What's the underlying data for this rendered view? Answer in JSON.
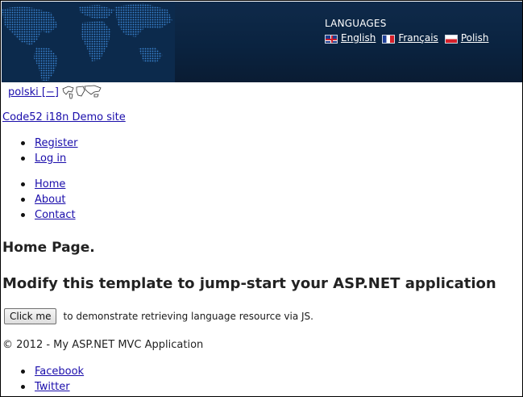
{
  "header": {
    "languages_title": "LANGUAGES",
    "languages": [
      {
        "label": "English",
        "flag": "uk-flag-icon"
      },
      {
        "label": "Français",
        "flag": "fr-flag-icon"
      },
      {
        "label": "Polish",
        "flag": "pl-flag-icon"
      }
    ],
    "background_color": "#0a2340"
  },
  "language_toggle": {
    "label": "polski [−]",
    "icon": "world-map-icon"
  },
  "site_title": "Code52 i18n Demo site",
  "auth_links": [
    {
      "label": "Register"
    },
    {
      "label": "Log in"
    }
  ],
  "nav_links": [
    {
      "label": "Home"
    },
    {
      "label": "About"
    },
    {
      "label": "Contact"
    }
  ],
  "main": {
    "heading": "Home Page.",
    "subheading": "Modify this template to jump-start your ASP.NET application",
    "button_label": "Click me",
    "button_hint": "to demonstrate retrieving language resource via JS."
  },
  "footer": {
    "copyright": "© 2012 - My ASP.NET MVC Application",
    "social_links": [
      {
        "label": "Facebook"
      },
      {
        "label": "Twitter"
      }
    ]
  },
  "colors": {
    "link": "#1a0dab",
    "header_bg": "#0a2340"
  }
}
